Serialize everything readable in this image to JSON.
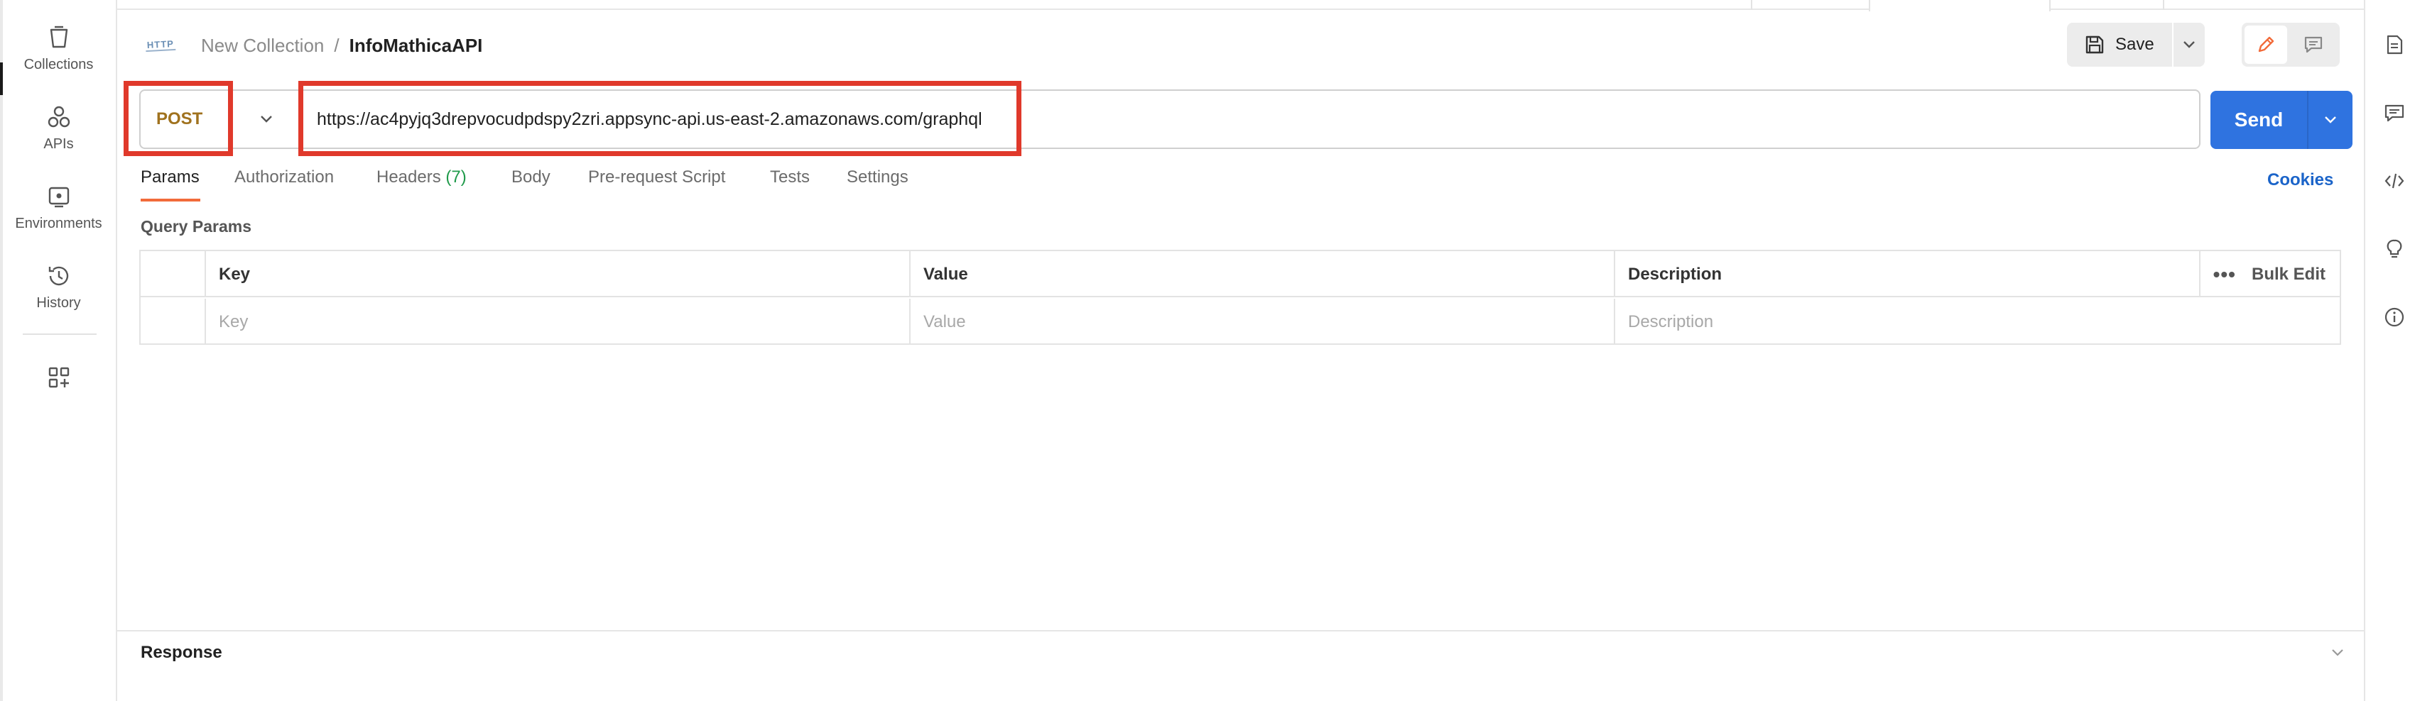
{
  "sidebar": {
    "items": [
      {
        "label": "Collections",
        "icon": "trash-can-like-collections-icon"
      },
      {
        "label": "APIs",
        "icon": "apis-icon"
      },
      {
        "label": "Environments",
        "icon": "environments-icon"
      },
      {
        "label": "History",
        "icon": "history-icon"
      }
    ],
    "extra_icon": "add-workspace-grid-icon"
  },
  "header": {
    "http_badge": "HTTP",
    "collection": "New Collection",
    "separator": "/",
    "request_name": "InfoMathicaAPI",
    "save_label": "Save"
  },
  "request": {
    "method": "POST",
    "url": "https://ac4pyjq3drepvocudpdspy2zri.appsync-api.us-east-2.amazonaws.com/graphql",
    "send_label": "Send"
  },
  "tabs": [
    {
      "label": "Params",
      "active": true
    },
    {
      "label": "Authorization"
    },
    {
      "label": "Headers",
      "count": "(7)"
    },
    {
      "label": "Body"
    },
    {
      "label": "Pre-request Script"
    },
    {
      "label": "Tests"
    },
    {
      "label": "Settings"
    }
  ],
  "cookies_label": "Cookies",
  "query_params": {
    "title": "Query Params",
    "columns": [
      "Key",
      "Value",
      "Description"
    ],
    "bulk_edit": "Bulk Edit",
    "placeholders": {
      "key": "Key",
      "value": "Value",
      "description": "Description"
    }
  },
  "response": {
    "title": "Response"
  },
  "colors": {
    "accent_orange": "#f26b3a",
    "send_blue": "#2f73e0",
    "method_post": "#a0721e",
    "highlight_red": "#e0392b",
    "cookies_link": "#1b64c9"
  }
}
